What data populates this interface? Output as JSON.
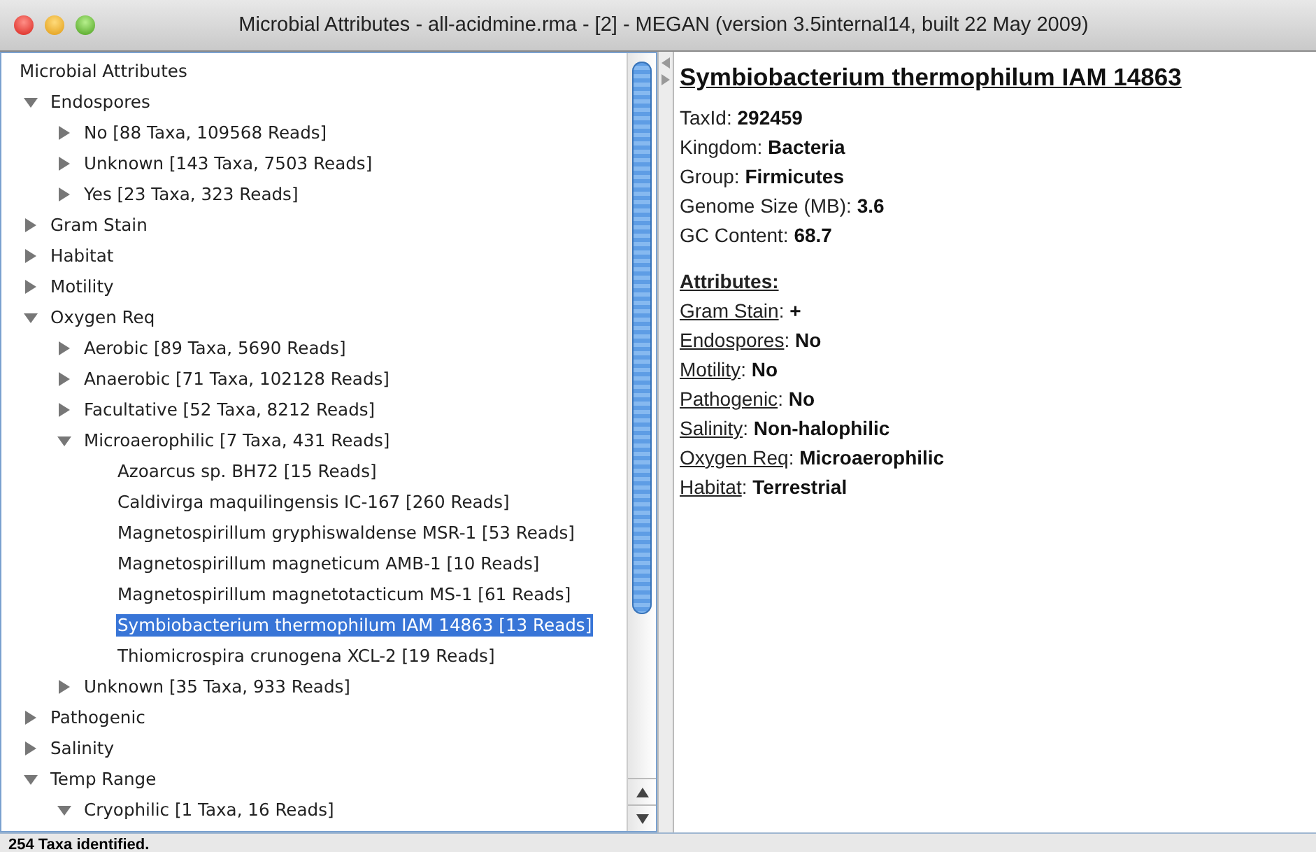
{
  "window": {
    "title": "Microbial Attributes - all-acidmine.rma - [2] - MEGAN (version 3.5internal14, built 22 May 2009)"
  },
  "tree": {
    "label": "Microbial Attributes",
    "children": [
      {
        "label": "Endospores",
        "expanded": true,
        "children": [
          {
            "label": "No [88 Taxa, 109568 Reads]",
            "expanded": false
          },
          {
            "label": "Unknown [143 Taxa, 7503 Reads]",
            "expanded": false
          },
          {
            "label": "Yes [23 Taxa, 323 Reads]",
            "expanded": false
          }
        ]
      },
      {
        "label": "Gram Stain",
        "expanded": false
      },
      {
        "label": "Habitat",
        "expanded": false
      },
      {
        "label": "Motility",
        "expanded": false
      },
      {
        "label": "Oxygen Req",
        "expanded": true,
        "children": [
          {
            "label": "Aerobic [89 Taxa, 5690 Reads]",
            "expanded": false
          },
          {
            "label": "Anaerobic [71 Taxa, 102128 Reads]",
            "expanded": false
          },
          {
            "label": "Facultative [52 Taxa, 8212 Reads]",
            "expanded": false
          },
          {
            "label": "Microaerophilic [7 Taxa, 431 Reads]",
            "expanded": true,
            "children": [
              {
                "label": "Azoarcus sp. BH72 [15 Reads]",
                "selected": false
              },
              {
                "label": "Caldivirga maquilingensis IC-167 [260 Reads]",
                "selected": false
              },
              {
                "label": "Magnetospirillum gryphiswaldense MSR-1 [53 Reads]",
                "selected": false
              },
              {
                "label": "Magnetospirillum magneticum AMB-1 [10 Reads]",
                "selected": false
              },
              {
                "label": "Magnetospirillum magnetotacticum MS-1 [61 Reads]",
                "selected": false
              },
              {
                "label": "Symbiobacterium thermophilum IAM 14863 [13 Reads]",
                "selected": true
              },
              {
                "label": "Thiomicrospira crunogena XCL-2 [19 Reads]",
                "selected": false
              }
            ]
          },
          {
            "label": "Unknown [35 Taxa, 933 Reads]",
            "expanded": false
          }
        ]
      },
      {
        "label": "Pathogenic",
        "expanded": false
      },
      {
        "label": "Salinity",
        "expanded": false
      },
      {
        "label": "Temp Range",
        "expanded": true,
        "children": [
          {
            "label": "Cryophilic [1 Taxa, 16 Reads]",
            "expanded": true
          }
        ]
      }
    ]
  },
  "details": {
    "title": "Symbiobacterium thermophilum IAM 14863",
    "fields": [
      {
        "label": "TaxId:",
        "value": "292459"
      },
      {
        "label": "Kingdom:",
        "value": "Bacteria"
      },
      {
        "label": "Group:",
        "value": "Firmicutes"
      },
      {
        "label": "Genome Size (MB):",
        "value": "3.6"
      },
      {
        "label": "GC Content:",
        "value": "68.7"
      }
    ],
    "attributes_heading": "Attributes:",
    "attributes": [
      {
        "label": "Gram Stain",
        "separator": ":",
        "value": "+"
      },
      {
        "label": "Endospores",
        "separator": ":",
        "value": "No"
      },
      {
        "label": "Motility",
        "separator": ":",
        "value": "No"
      },
      {
        "label": "Pathogenic",
        "separator": ":",
        "value": "No"
      },
      {
        "label": "Salinity",
        "separator": ":",
        "value": "Non-halophilic"
      },
      {
        "label": "Oxygen Req",
        "separator": ":",
        "value": "Microaerophilic"
      },
      {
        "label": "Habitat",
        "separator": ":",
        "value": "Terrestrial"
      }
    ]
  },
  "status_bar": "254 Taxa identified."
}
